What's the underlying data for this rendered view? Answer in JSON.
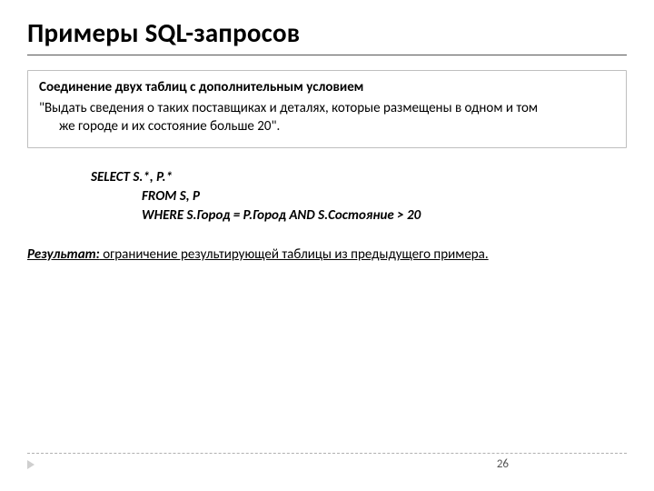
{
  "title": "Примеры SQL-запросов",
  "box": {
    "legend": "Соединение двух таблиц с дополнительным условием",
    "para_line1": "\"Выдать сведения о таких поставщиках и деталях, которые размещены в одном и том",
    "para_line2": "же городе и их состояние больше 20\"."
  },
  "code": {
    "l1": "SELECT  S.*,  P.*",
    "l2": "FROM  S, P",
    "l3": "WHERE  S.Город = P.Город  AND  S.Состояние > 20"
  },
  "result": {
    "label": "Результат:",
    "text": " ограничение результирующей таблицы из предыдущего примера."
  },
  "page": "26"
}
